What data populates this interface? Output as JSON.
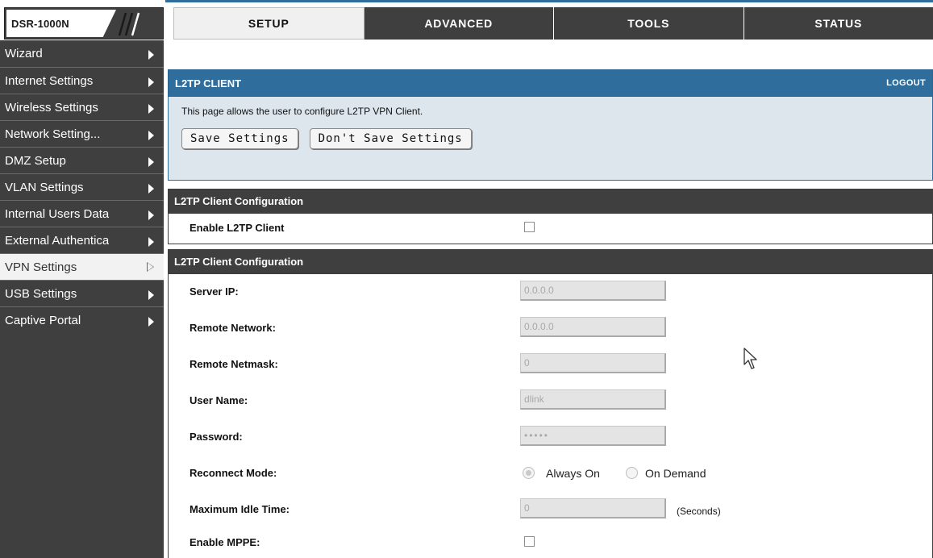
{
  "brand": {
    "model": "DSR-1000N"
  },
  "nav": {
    "tabs": [
      {
        "label": "SETUP"
      },
      {
        "label": "ADVANCED"
      },
      {
        "label": "TOOLS"
      },
      {
        "label": "STATUS"
      }
    ],
    "active": "SETUP"
  },
  "sidebar": {
    "items": [
      {
        "label": "Wizard"
      },
      {
        "label": "Internet Settings"
      },
      {
        "label": "Wireless Settings"
      },
      {
        "label": "Network Setting..."
      },
      {
        "label": "DMZ Setup"
      },
      {
        "label": "VLAN Settings"
      },
      {
        "label": "Internal Users Data"
      },
      {
        "label": "External Authentica"
      },
      {
        "label": "VPN Settings"
      },
      {
        "label": "USB Settings"
      },
      {
        "label": "Captive Portal"
      }
    ],
    "active": "VPN Settings"
  },
  "panel": {
    "title": "L2TP CLIENT",
    "logout": "LOGOUT",
    "description": "This page allows the user to configure L2TP VPN Client.",
    "save_label": "Save Settings",
    "dont_save_label": "Don't Save Settings"
  },
  "section1": {
    "title": "L2TP Client Configuration",
    "enable_label": "Enable L2TP Client",
    "enable_checked": false
  },
  "section2": {
    "title": "L2TP Client Configuration",
    "server_ip": {
      "label": "Server IP:",
      "value": "0.0.0.0"
    },
    "remote_network": {
      "label": "Remote Network:",
      "value": "0.0.0.0"
    },
    "remote_netmask": {
      "label": "Remote Netmask:",
      "value": "0"
    },
    "user_name": {
      "label": "User Name:",
      "value": "dlink"
    },
    "password": {
      "label": "Password:",
      "value": "•••••"
    },
    "reconnect_mode": {
      "label": "Reconnect Mode:",
      "options": [
        "Always On",
        "On Demand"
      ],
      "selected": "Always On"
    },
    "max_idle_time": {
      "label": "Maximum Idle Time:",
      "value": "0",
      "unit": "(Seconds)"
    },
    "enable_mppe": {
      "label": "Enable MPPE:",
      "checked": false
    }
  },
  "colors": {
    "header_blue": "#2f6e9c",
    "dark_gray": "#3f3f3f",
    "info_bg": "#dde6ec"
  }
}
